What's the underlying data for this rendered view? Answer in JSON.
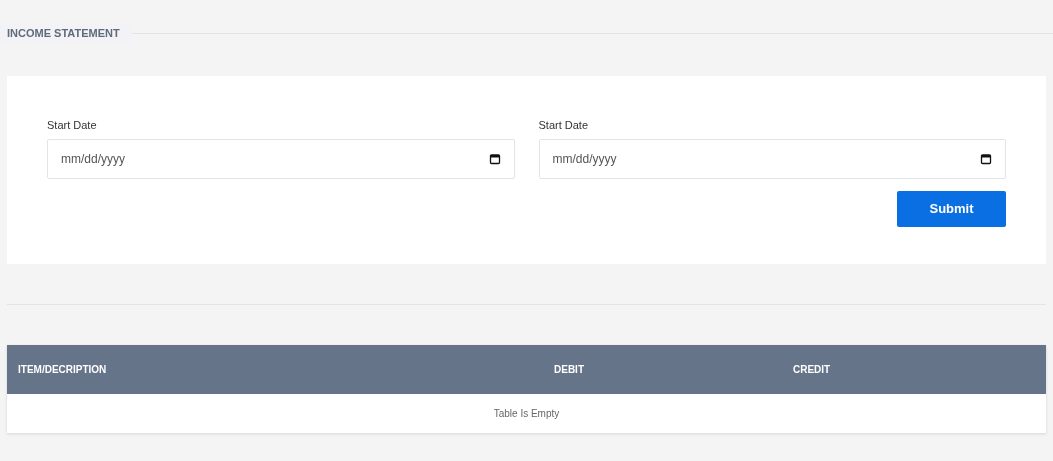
{
  "section_title": "INCOME STATEMENT",
  "fields": [
    {
      "label": "Start Date",
      "placeholder": "mm/dd/yyyy"
    },
    {
      "label": "Start Date",
      "placeholder": "mm/dd/yyyy"
    }
  ],
  "submit_button": "Submit",
  "table": {
    "columns": [
      "ITEM/DECRIPTION",
      "DEBIT",
      "CREDIT"
    ],
    "empty_message": "Table Is Empty"
  }
}
